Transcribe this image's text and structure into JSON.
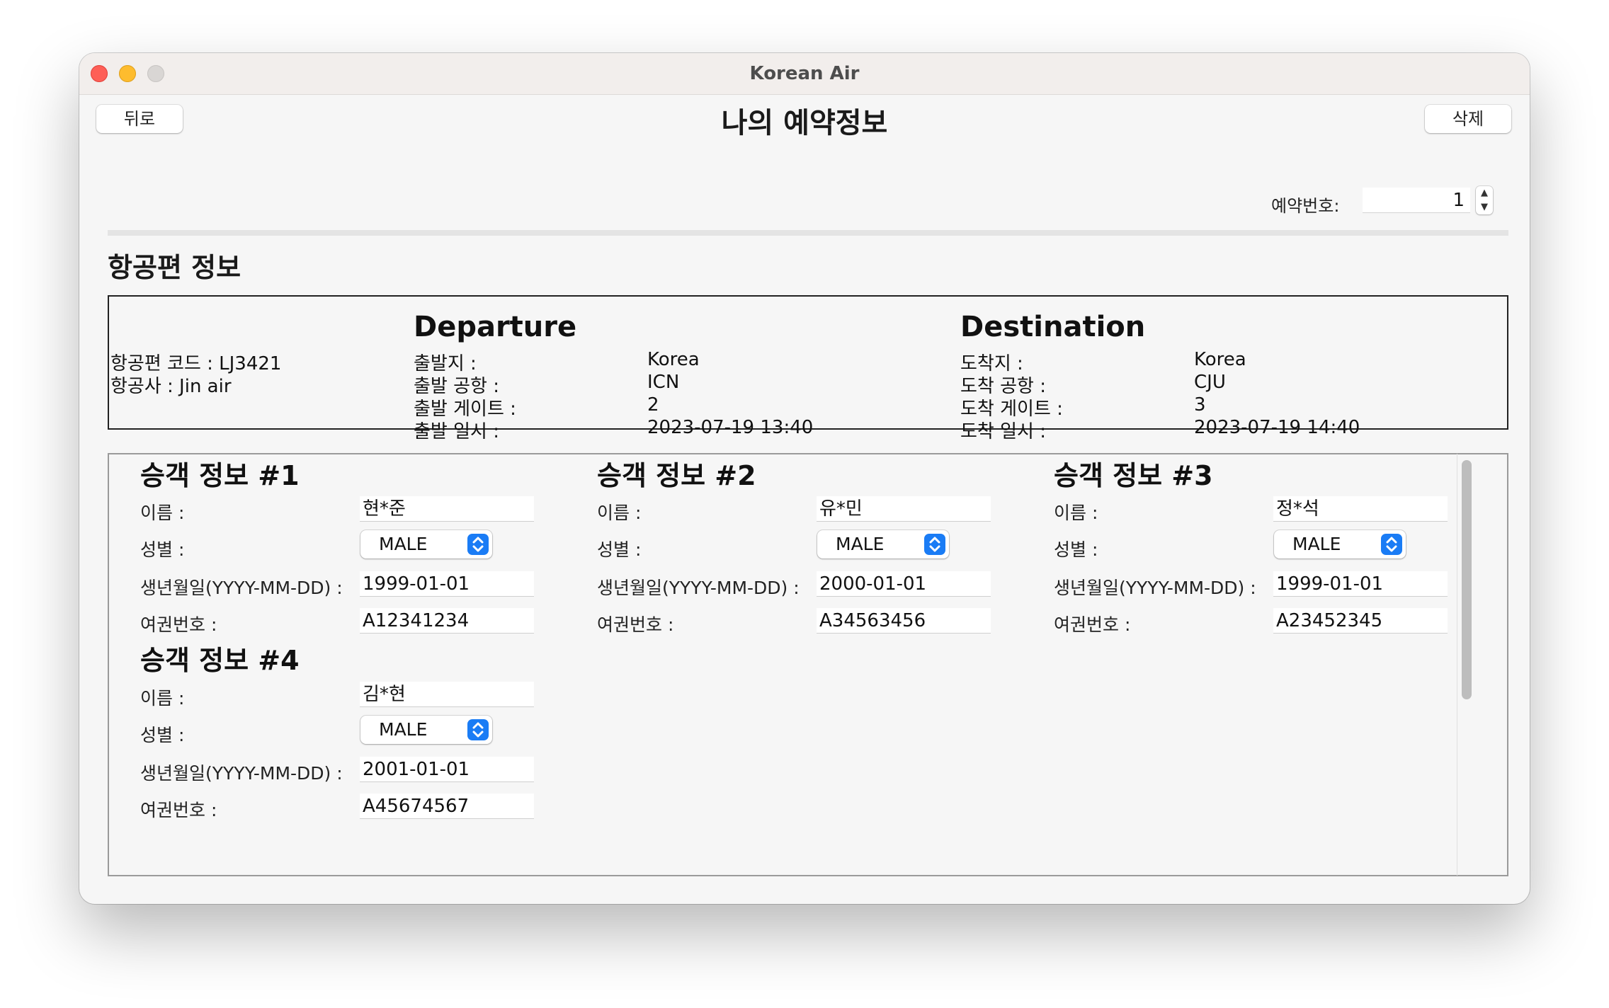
{
  "window": {
    "title": "Korean Air"
  },
  "toolbar": {
    "back_label": "뒤로",
    "delete_label": "삭제"
  },
  "page": {
    "title": "나의 예약정보"
  },
  "reservation": {
    "label": "예약번호:",
    "value": "1"
  },
  "flight_section": {
    "title": "항공편 정보",
    "code_text": "항공편 코드 : LJ3421",
    "airline_text": "항공사 : Jin air",
    "departure": {
      "heading": "Departure",
      "place_label": "출발지 :",
      "place": "Korea",
      "airport_label": "출발 공항 :",
      "airport": "ICN",
      "gate_label": "출발 게이트 :",
      "gate": "2",
      "time_label": "출발 일시 :",
      "time": "2023-07-19 13:40"
    },
    "destination": {
      "heading": "Destination",
      "place_label": "도착지 :",
      "place": "Korea",
      "airport_label": "도착 공항 :",
      "airport": "CJU",
      "gate_label": "도착 게이트 :",
      "gate": "3",
      "time_label": "도착 일시 :",
      "time": "2023-07-19 14:40"
    }
  },
  "labels": {
    "name": "이름 :",
    "gender": "성별 :",
    "birth": "생년월일(YYYY-MM-DD) :",
    "passport": "여권번호 :"
  },
  "passengers": [
    {
      "title": "승객 정보 #1",
      "name": "현*준",
      "gender": "MALE",
      "birth": "1999-01-01",
      "passport": "A12341234"
    },
    {
      "title": "승객 정보 #2",
      "name": "유*민",
      "gender": "MALE",
      "birth": "2000-01-01",
      "passport": "A34563456"
    },
    {
      "title": "승객 정보 #3",
      "name": "정*석",
      "gender": "MALE",
      "birth": "1999-01-01",
      "passport": "A23452345"
    },
    {
      "title": "승객 정보 #4",
      "name": "김*현",
      "gender": "MALE",
      "birth": "2001-01-01",
      "passport": "A45674567"
    }
  ],
  "colors": {
    "accent": "#1a7cf5",
    "close": "#fe5f57",
    "minimize": "#febc2e"
  }
}
